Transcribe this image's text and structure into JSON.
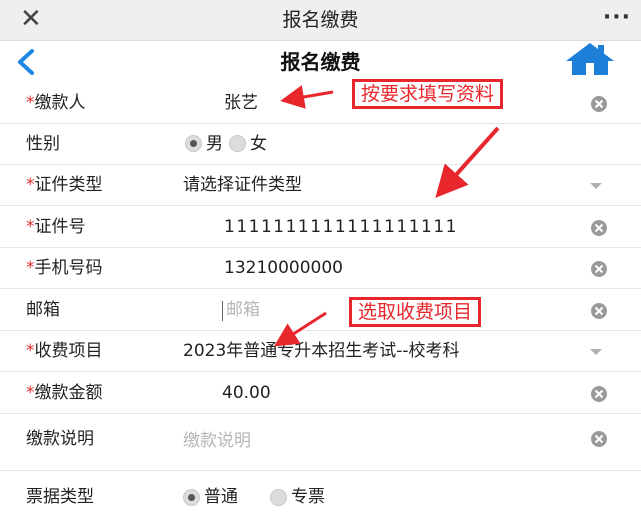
{
  "window": {
    "title": "报名缴费",
    "close_icon": "close-icon",
    "more_label": "···"
  },
  "header": {
    "title": "报名缴费",
    "back_icon": "chevron-left-icon",
    "home_icon": "home-icon",
    "accent": "#1e88e5"
  },
  "required_mark": "*",
  "form": {
    "payer": {
      "label": "缴款人",
      "value": "张艺"
    },
    "gender": {
      "label": "性别",
      "options": [
        "男",
        "女"
      ],
      "selected": "男"
    },
    "id_type": {
      "label": "证件类型",
      "value": "请选择证件类型"
    },
    "id_number": {
      "label": "证件号",
      "value": "1111111111111111111"
    },
    "phone": {
      "label": "手机号码",
      "value": "13210000000"
    },
    "email": {
      "label": "邮箱",
      "placeholder": "邮箱"
    },
    "fee_item": {
      "label": "收费项目",
      "value": "2023年普通专升本招生考试--校考科"
    },
    "amount": {
      "label": "缴款金额",
      "value": "40.00"
    },
    "note": {
      "label": "缴款说明",
      "placeholder": "缴款说明"
    },
    "receipt_type": {
      "label": "票据类型",
      "options": [
        "普通",
        "专票"
      ],
      "selected": "普通"
    }
  },
  "annotations": {
    "fill_in": "按要求填写资料",
    "select_fee": "选取收费项目",
    "color": "#e8272d"
  },
  "colors": {
    "required": "#e0302b",
    "placeholder": "#b5b5b5",
    "titlebar": "#efefef"
  }
}
